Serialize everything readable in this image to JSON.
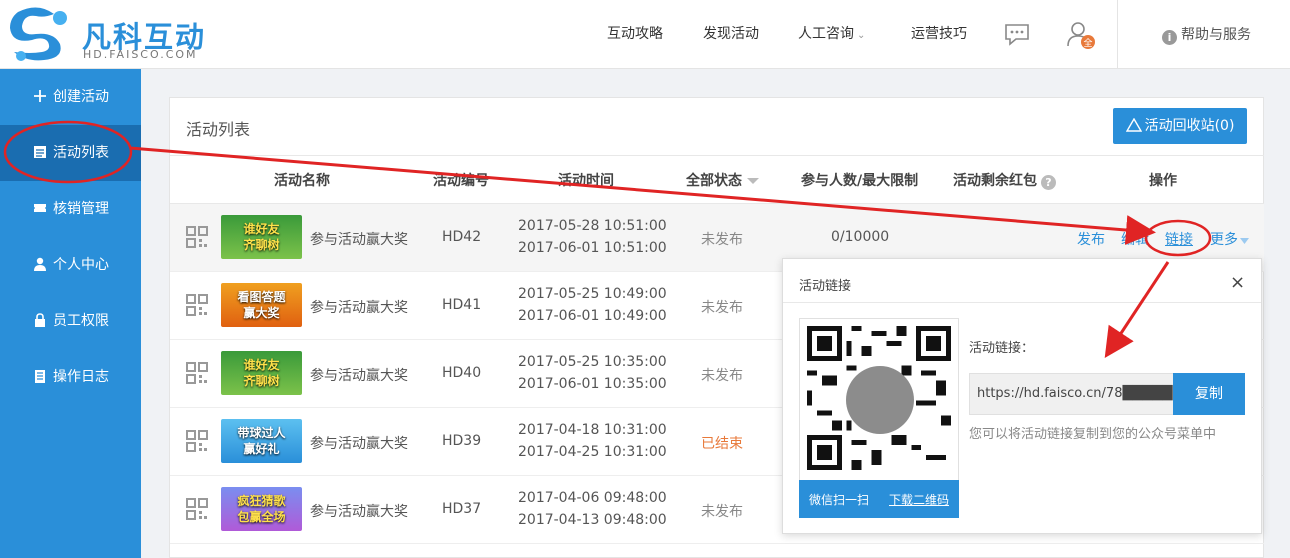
{
  "header": {
    "logo_text": "凡科互动",
    "logo_sub": "HD.FAISCO.COM",
    "nav": [
      "互动攻略",
      "发现活动",
      "人工咨询",
      "运营技巧"
    ],
    "chev": "⌄",
    "user_badge": "全",
    "help_label": "帮助与服务",
    "help_icon_glyph": "i"
  },
  "sidebar": {
    "items": [
      {
        "label": "创建活动",
        "icon": "plus-icon"
      },
      {
        "label": "活动列表",
        "icon": "list-icon"
      },
      {
        "label": "核销管理",
        "icon": "ticket-icon"
      },
      {
        "label": "个人中心",
        "icon": "person-icon"
      },
      {
        "label": "员工权限",
        "icon": "lock-icon"
      },
      {
        "label": "操作日志",
        "icon": "log-icon"
      }
    ]
  },
  "main": {
    "title": "活动列表",
    "recycle_label": "活动回收站(0)",
    "columns": [
      "活动名称",
      "活动编号",
      "活动时间",
      "全部状态",
      "参与人数/最大限制",
      "活动剩余红包",
      "操作"
    ],
    "help_glyph": "?",
    "rows": [
      {
        "thumb_text": "谁好友\n齐聊树",
        "name": "参与活动赢大奖",
        "id": "HD42",
        "start": "2017-05-28 10:51:00",
        "end": "2017-06-01 10:51:00",
        "status": "未发布",
        "participants": "0/10000"
      },
      {
        "thumb_text": "看图答题\n赢大奖",
        "name": "参与活动赢大奖",
        "id": "HD41",
        "start": "2017-05-25 10:49:00",
        "end": "2017-06-01 10:49:00",
        "status": "未发布",
        "participants": ""
      },
      {
        "thumb_text": "谁好友\n齐聊树",
        "name": "参与活动赢大奖",
        "id": "HD40",
        "start": "2017-05-25 10:35:00",
        "end": "2017-06-01 10:35:00",
        "status": "未发布",
        "participants": ""
      },
      {
        "thumb_text": "带球过人\n赢好礼",
        "name": "参与活动赢大奖",
        "id": "HD39",
        "start": "2017-04-18 10:31:00",
        "end": "2017-04-25 10:31:00",
        "status": "已结束",
        "participants": ""
      },
      {
        "thumb_text": "疯狂猜歌\n包赢全场",
        "name": "参与活动赢大奖",
        "id": "HD37",
        "start": "2017-04-06 09:48:00",
        "end": "2017-04-13 09:48:00",
        "status": "未发布",
        "participants": ""
      }
    ],
    "ops": {
      "publish": "发布",
      "edit": "编辑",
      "link": "链接",
      "more": "更多"
    }
  },
  "popup": {
    "title": "活动链接",
    "close": "×",
    "scan_label": "微信扫一扫",
    "download_label": "下载二维码",
    "link_label": "活动链接：",
    "link_value": "https://hd.faisco.cn/78█████4/",
    "copy_label": "复制",
    "hint": "您可以将活动链接复制到您的公众号菜单中"
  },
  "colors": {
    "accent": "#2a8fd9",
    "annotation": "#e02424",
    "ended": "#e8793a"
  }
}
